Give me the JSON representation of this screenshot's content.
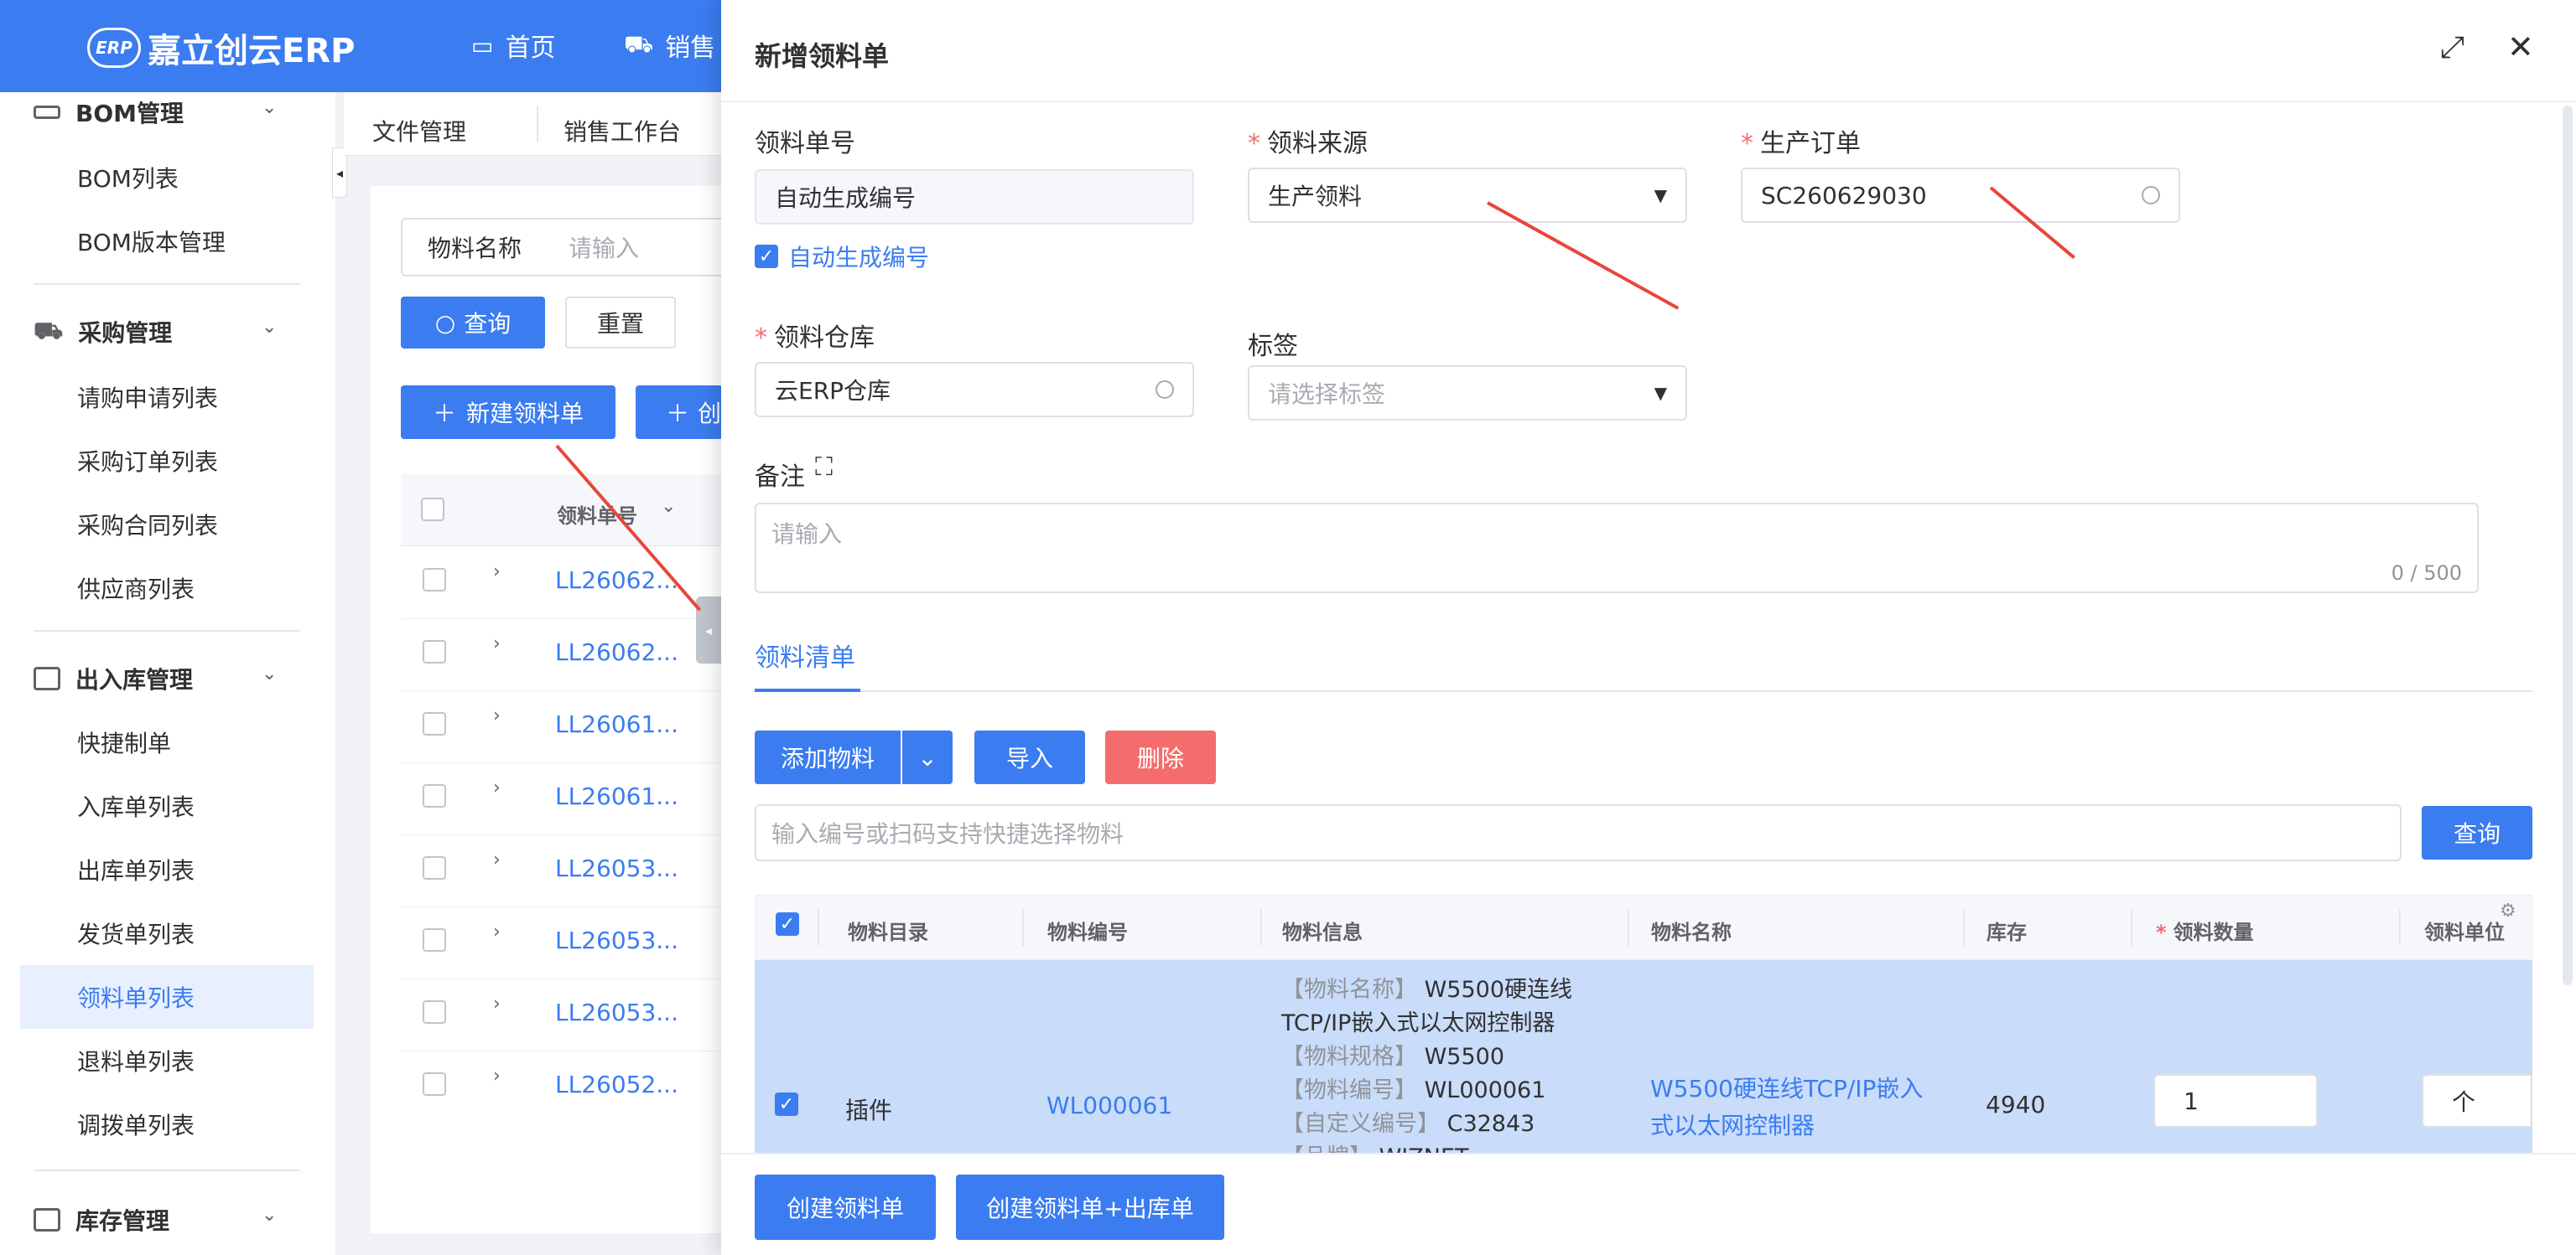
{
  "app": {
    "brand": "嘉立创云ERP",
    "logo_badge": "ERP"
  },
  "topnav": [
    {
      "label": "首页",
      "icon": "monitor-icon"
    },
    {
      "label": "销售",
      "icon": "cart-icon"
    }
  ],
  "sidebar": {
    "groups": [
      {
        "label": "BOM管理",
        "icon": "bom-icon",
        "items": [
          "BOM列表",
          "BOM版本管理"
        ]
      },
      {
        "label": "采购管理",
        "icon": "cart-icon",
        "items": [
          "请购申请列表",
          "采购订单列表",
          "采购合同列表",
          "供应商列表"
        ]
      },
      {
        "label": "出入库管理",
        "icon": "warehouse-icon",
        "items": [
          "快捷制单",
          "入库单列表",
          "出库单列表",
          "发货单列表",
          "领料单列表",
          "退料单列表",
          "调拨单列表"
        ]
      },
      {
        "label": "库存管理",
        "icon": "inventory-icon",
        "items": []
      }
    ],
    "active_item": "领料单列表"
  },
  "tabs": [
    "文件管理",
    "销售工作台"
  ],
  "list": {
    "filter_label": "物料名称",
    "filter_placeholder": "请输入",
    "query_button": "查询",
    "reset_button": "重置",
    "new_button": "新建领料单",
    "create_button_partial": "创",
    "column": "领料单号",
    "rows": [
      "LL26062...",
      "LL26062...",
      "LL26061...",
      "LL26061...",
      "LL26053...",
      "LL26053...",
      "LL26053...",
      "LL26052..."
    ]
  },
  "drawer": {
    "title": "新增领料单",
    "fields": {
      "order_no": {
        "label": "领料单号",
        "value": "自动生成编号"
      },
      "auto_gen": {
        "label": "自动生成编号",
        "checked": true
      },
      "source": {
        "label": "领料来源",
        "value": "生产领料",
        "required": true
      },
      "production_order": {
        "label": "生产订单",
        "value": "SC260629030",
        "required": true
      },
      "warehouse": {
        "label": "领料仓库",
        "value": "云ERP仓库",
        "required": true
      },
      "tags": {
        "label": "标签",
        "placeholder": "请选择标签"
      },
      "remark": {
        "label": "备注",
        "placeholder": "请输入",
        "counter": "0 / 500"
      }
    },
    "sub_tab": "领料清单",
    "actions": {
      "add_material": "添加物料",
      "import": "导入",
      "delete": "删除",
      "query": "查询"
    },
    "search_placeholder": "输入编号或扫码支持快捷选择物料",
    "grid": {
      "headers": [
        "物料目录",
        "物料编号",
        "物料信息",
        "物料名称",
        "库存",
        "领料数量",
        "领料单位"
      ],
      "rows": [
        {
          "category": "插件",
          "code": "WL000061",
          "info": [
            {
              "k": "【物料名称】",
              "v": "W5500硬连线"
            },
            {
              "k": "",
              "v": "TCP/IP嵌入式以太网控制器"
            },
            {
              "k": "【物料规格】",
              "v": "W5500"
            },
            {
              "k": "【物料编号】",
              "v": "WL000061"
            },
            {
              "k": "【自定义编号】",
              "v": "C32843"
            },
            {
              "k": "【品牌】",
              "v": "WIZNET"
            }
          ],
          "name_line1": "W5500硬连线TCP/IP嵌入",
          "name_line2": "式以太网控制器",
          "stock": "4940",
          "qty": "1",
          "unit": "个"
        }
      ]
    },
    "footer": {
      "create": "创建领料单",
      "create_outbound": "创建领料单+出库单"
    }
  },
  "colors": {
    "primary": "#3b7cf0",
    "danger": "#f56c6c",
    "arrow": "#e8463a"
  }
}
